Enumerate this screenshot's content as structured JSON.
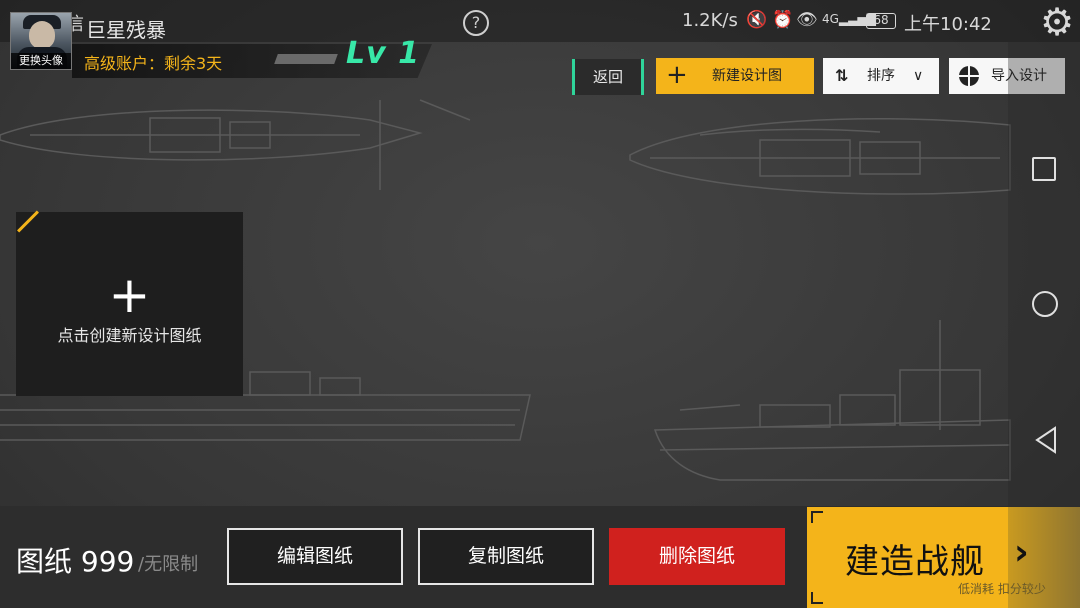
{
  "status_bar": {
    "carrier": "中国电信",
    "help_icon": "?",
    "speed": "1.2K/s",
    "battery": "68",
    "time": "上午10:42"
  },
  "player": {
    "name": "巨星残暴",
    "avatar_label": "更换头像",
    "account_status": "高级账户：剩余3天",
    "level": "Lv 1"
  },
  "toolbar": {
    "back_label": "返回",
    "new_design_label": "新建设计图",
    "sort_label": "排序",
    "import_label": "导入设计"
  },
  "create_card": {
    "plus": "+",
    "label": "点击创建新设计图纸"
  },
  "bottom": {
    "count_label": "图纸 999",
    "limit_label": "/无限制",
    "edit_label": "编辑图纸",
    "copy_label": "复制图纸",
    "delete_label": "删除图纸",
    "build_label": "建造战舰",
    "build_sub_label": "低消耗 扣分较少"
  },
  "colors": {
    "accent": "#f4b41a",
    "level": "#38e8a8",
    "delete": "#d0211e"
  }
}
